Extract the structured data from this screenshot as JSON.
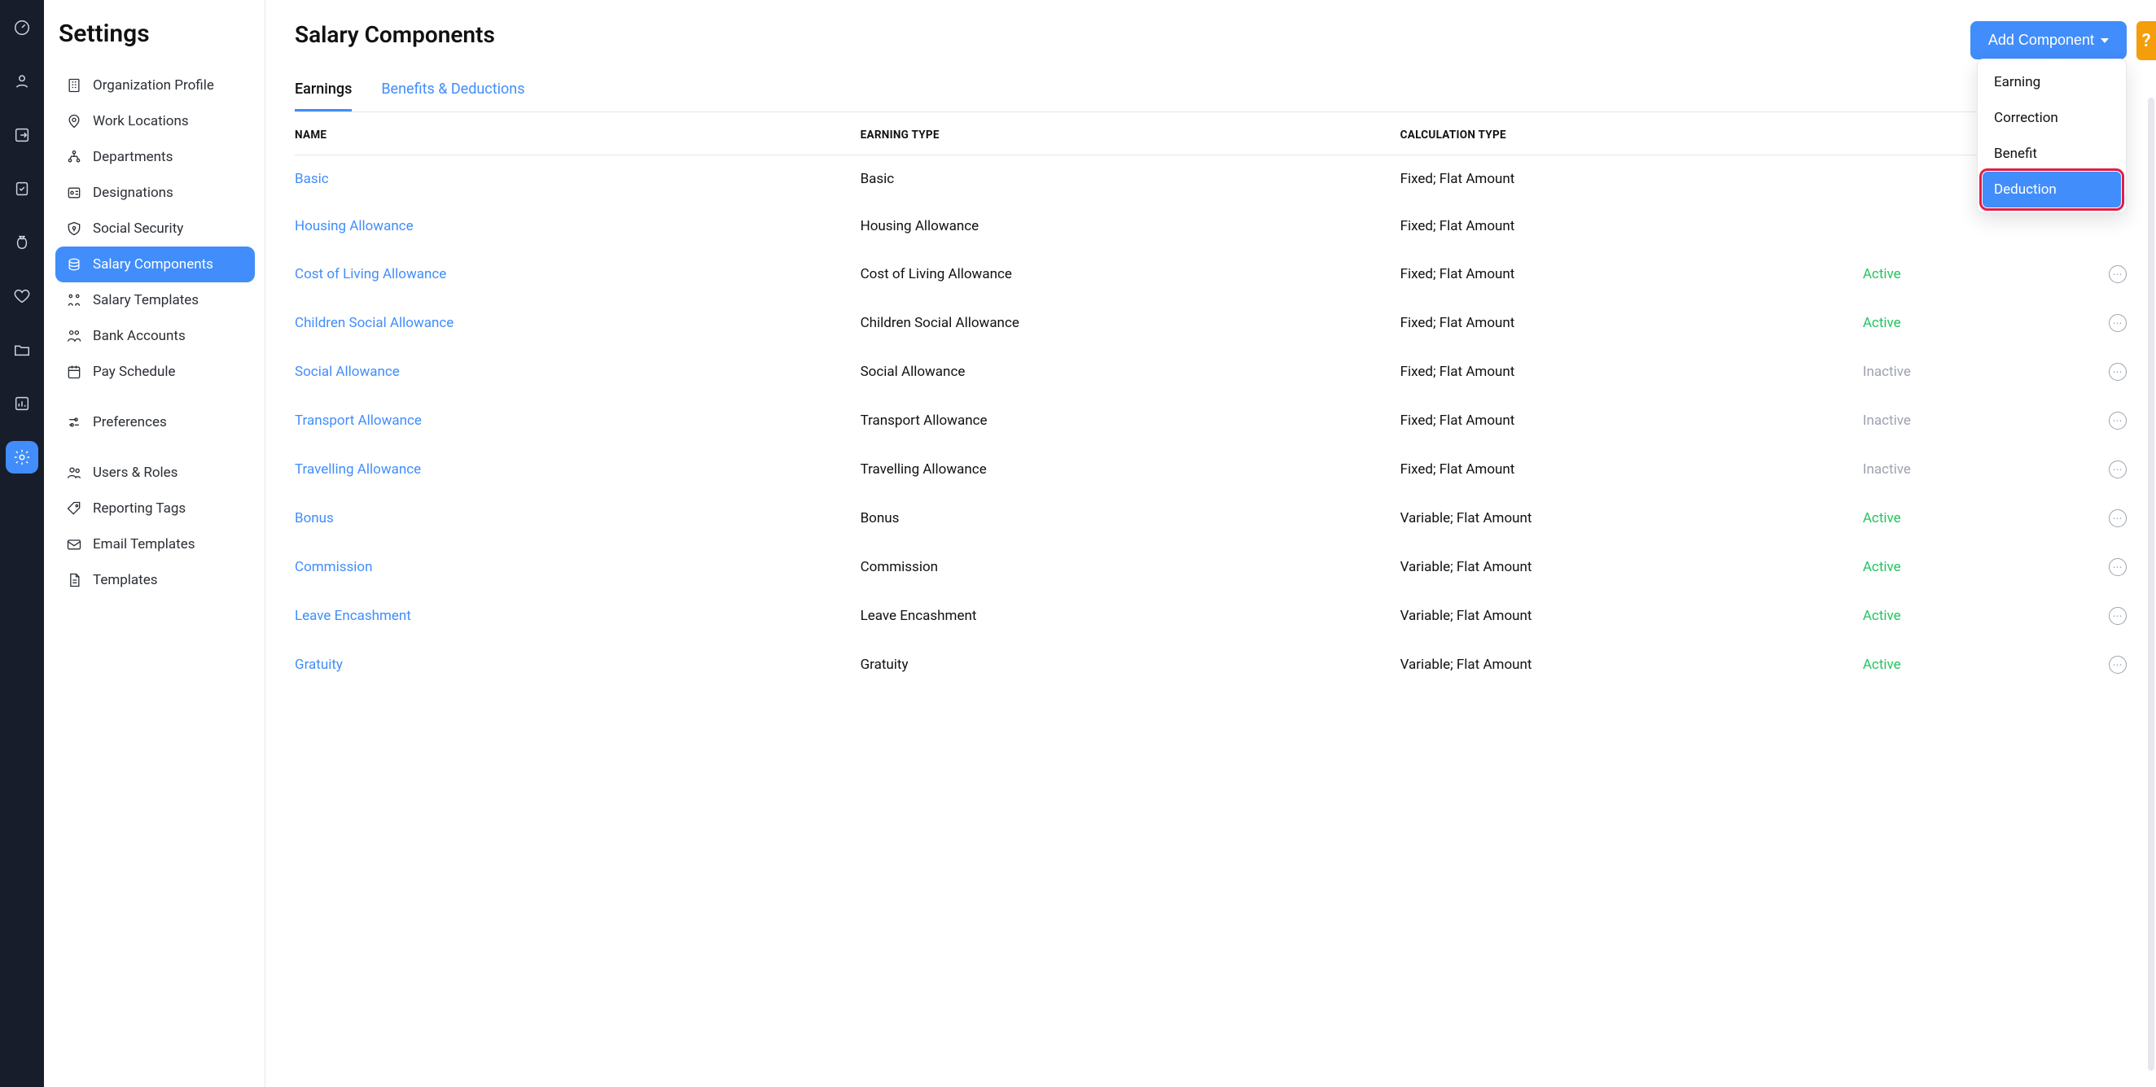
{
  "rail": {
    "items": [
      {
        "name": "dashboard-icon"
      },
      {
        "name": "people-icon"
      },
      {
        "name": "box-arrow-icon"
      },
      {
        "name": "checklist-icon"
      },
      {
        "name": "money-bag-icon"
      },
      {
        "name": "heart-icon"
      },
      {
        "name": "folder-icon"
      },
      {
        "name": "chart-icon"
      },
      {
        "name": "settings-icon"
      }
    ],
    "active_index": 8
  },
  "sidebar": {
    "title": "Settings",
    "items": [
      {
        "label": "Organization Profile",
        "icon": "building-icon"
      },
      {
        "label": "Work Locations",
        "icon": "pin-icon"
      },
      {
        "label": "Departments",
        "icon": "org-icon"
      },
      {
        "label": "Designations",
        "icon": "badge-icon"
      },
      {
        "label": "Social Security",
        "icon": "shield-key-icon"
      },
      {
        "label": "Salary Components",
        "icon": "coins-icon"
      },
      {
        "label": "Salary Templates",
        "icon": "template-icon"
      },
      {
        "label": "Bank Accounts",
        "icon": "bank-icon"
      },
      {
        "label": "Pay Schedule",
        "icon": "calendar-icon"
      },
      {
        "label": "Preferences",
        "icon": "sliders-icon"
      },
      {
        "label": "Users & Roles",
        "icon": "users-icon"
      },
      {
        "label": "Reporting Tags",
        "icon": "tag-icon"
      },
      {
        "label": "Email Templates",
        "icon": "mail-icon"
      },
      {
        "label": "Templates",
        "icon": "doc-icon"
      }
    ],
    "active_index": 5
  },
  "page": {
    "title": "Salary Components",
    "add_button": "Add Component",
    "help_label": "?",
    "tabs": [
      {
        "label": "Earnings"
      },
      {
        "label": "Benefits & Deductions"
      }
    ],
    "active_tab": 0,
    "columns": {
      "name": "Name",
      "earning_type": "Earning Type",
      "calc_type": "Calculation Type"
    },
    "rows": [
      {
        "name": "Basic",
        "earning_type": "Basic",
        "calc": "Fixed; Flat Amount",
        "status": "",
        "show_more": false
      },
      {
        "name": "Housing Allowance",
        "earning_type": "Housing Allowance",
        "calc": "Fixed; Flat Amount",
        "status": "",
        "show_more": false
      },
      {
        "name": "Cost of Living Allowance",
        "earning_type": "Cost of Living Allowance",
        "calc": "Fixed; Flat Amount",
        "status": "Active",
        "show_more": true
      },
      {
        "name": "Children Social Allowance",
        "earning_type": "Children Social Allowance",
        "calc": "Fixed; Flat Amount",
        "status": "Active",
        "show_more": true
      },
      {
        "name": "Social Allowance",
        "earning_type": "Social Allowance",
        "calc": "Fixed; Flat Amount",
        "status": "Inactive",
        "show_more": true
      },
      {
        "name": "Transport Allowance",
        "earning_type": "Transport Allowance",
        "calc": "Fixed; Flat Amount",
        "status": "Inactive",
        "show_more": true
      },
      {
        "name": "Travelling Allowance",
        "earning_type": "Travelling Allowance",
        "calc": "Fixed; Flat Amount",
        "status": "Inactive",
        "show_more": true
      },
      {
        "name": "Bonus",
        "earning_type": "Bonus",
        "calc": "Variable; Flat Amount",
        "status": "Active",
        "show_more": true
      },
      {
        "name": "Commission",
        "earning_type": "Commission",
        "calc": "Variable; Flat Amount",
        "status": "Active",
        "show_more": true
      },
      {
        "name": "Leave Encashment",
        "earning_type": "Leave Encashment",
        "calc": "Variable; Flat Amount",
        "status": "Active",
        "show_more": true
      },
      {
        "name": "Gratuity",
        "earning_type": "Gratuity",
        "calc": "Variable; Flat Amount",
        "status": "Active",
        "show_more": true
      }
    ],
    "dropdown": [
      {
        "label": "Earning",
        "highlight": false
      },
      {
        "label": "Correction",
        "highlight": false
      },
      {
        "label": "Benefit",
        "highlight": false
      },
      {
        "label": "Deduction",
        "highlight": true
      }
    ]
  }
}
